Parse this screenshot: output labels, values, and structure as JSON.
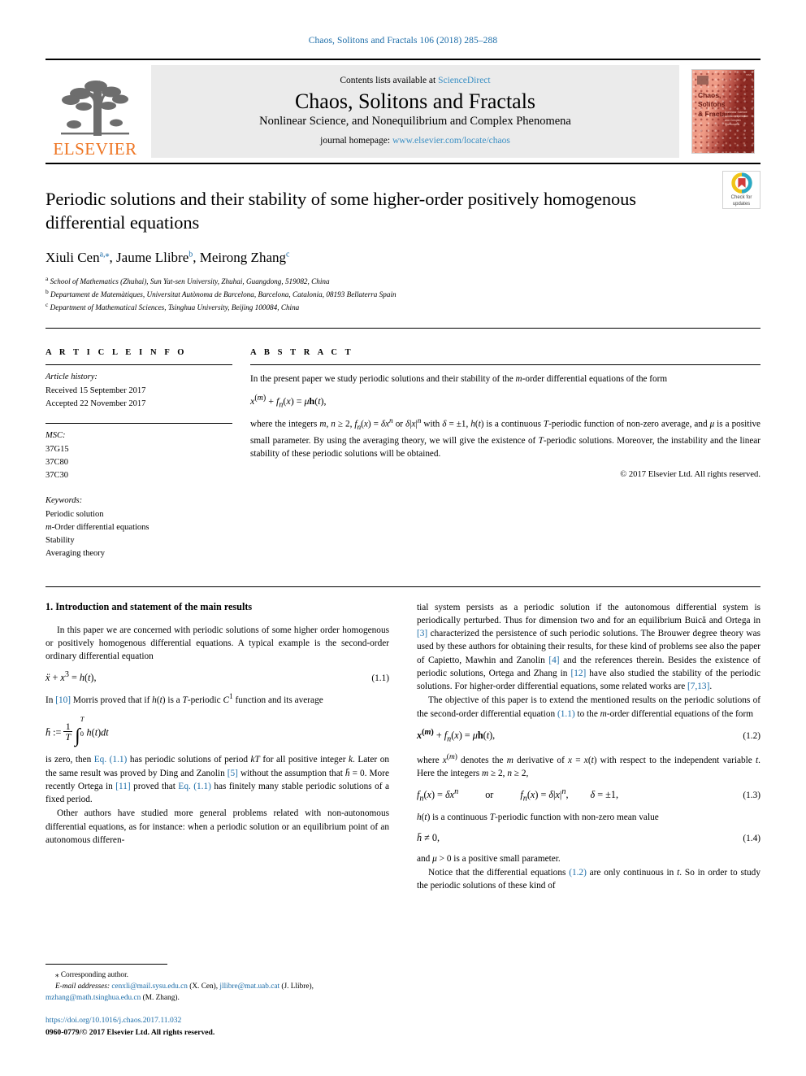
{
  "running_head": "Chaos, Solitons and Fractals 106 (2018) 285–288",
  "masthead": {
    "publisher": "ELSEVIER",
    "contents_prefix": "Contents lists available at ",
    "contents_link": "ScienceDirect",
    "journal_title": "Chaos, Solitons and Fractals",
    "journal_subtitle": "Nonlinear Science, and Nonequilibrium and Complex Phenomena",
    "homepage_prefix": "journal homepage: ",
    "homepage_link": "www.elsevier.com/locate/chaos",
    "cover": {
      "title_line1": "Chaos,",
      "title_line2": "Solitons",
      "title_line3": "& Fractals",
      "sub_text": "Nonlinear Science and Nonequilibrium and Complex Phenomena",
      "corner_text": "ISSN"
    }
  },
  "article": {
    "title": "Periodic solutions and their stability of some higher-order positively homogenous differential equations",
    "crossmark_label_line1": "Check for",
    "crossmark_label_line2": "updates",
    "authors_html": "Xiuli Cen<sup class=\"aff\">a</sup><sup class=\"star\">,⁎</sup>, Jaume Llibre<sup class=\"aff\">b</sup>, Meirong Zhang<sup class=\"aff\">c</sup>",
    "affiliations": [
      {
        "marker": "a",
        "text": "School of Mathematics (Zhuhai), Sun Yat-sen University, Zhuhai, Guangdong, 519082, China"
      },
      {
        "marker": "b",
        "text": "Departament de Matemàtiques, Universitat Autònoma de Barcelona, Barcelona, Catalonia, 08193 Bellaterra Spain"
      },
      {
        "marker": "c",
        "text": "Department of Mathematical Sciences, Tsinghua University, Beijing 100084, China"
      }
    ]
  },
  "article_info": {
    "heading": "A R T I C L E   I N F O",
    "history_label": "Article history:",
    "history": [
      "Received 15 September 2017",
      "Accepted 22 November 2017"
    ],
    "msc_label": "MSC:",
    "msc": [
      "37G15",
      "37C80",
      "37C30"
    ],
    "keywords_label": "Keywords:",
    "keywords": [
      "Periodic solution",
      "m-Order differential equations",
      "Stability",
      "Averaging theory"
    ]
  },
  "abstract": {
    "heading": "A B S T R A C T",
    "para1": "In the present paper we study periodic solutions and their stability of the m-order differential equations of the form",
    "equation": "x⁽ᵐ⁾ + fₙ(x) = μh(t),",
    "para2": "where the integers m, n ≥ 2, fₙ(x) = δxⁿ or δ|x|ⁿ with δ = ±1, h(t) is a continuous T-periodic function of non-zero average, and μ is a positive small parameter. By using the averaging theory, we will give the existence of T-periodic solutions. Moreover, the instability and the linear stability of these periodic solutions will be obtained.",
    "copyright": "© 2017 Elsevier Ltd. All rights reserved."
  },
  "body": {
    "section_title": "1. Introduction and statement of the main results",
    "left": {
      "p1": "In this paper we are concerned with periodic solutions of some higher order homogenous or positively homogenous differential equations. A typical example is the second-order ordinary differential equation",
      "eq11": "ẍ + x³ = h(t),",
      "eq11_num": "(1.1)",
      "p2_a": "In ",
      "p2_ref": "[10]",
      "p2_b": " Morris proved that if h(t) is a T-periodic C¹ function and its average",
      "eq_avg": "h̄ := (1/T) ∫₀ᵀ h(t)dt",
      "p3_a": "is zero, then ",
      "p3_ref1": "Eq. (1.1)",
      "p3_b": " has periodic solutions of period kT for all positive integer k. Later on the same result was proved by Ding and Zanolin ",
      "p3_ref2": "[5]",
      "p3_c": " without the assumption that h̄ = 0. More recently Ortega in ",
      "p3_ref3": "[11]",
      "p3_d": " proved that ",
      "p3_ref4": "Eq. (1.1)",
      "p3_e": " has finitely many stable periodic solutions of a fixed period.",
      "p4": "Other authors have studied more general problems related with non-autonomous differential equations, as for instance: when a periodic solution or an equilibrium point of an autonomous differen-"
    },
    "right": {
      "p1_a": "tial system persists as a periodic solution if the autonomous differential system is periodically perturbed. Thus for dimension two and for an equilibrium Buică and Ortega in ",
      "p1_ref1": "[3]",
      "p1_b": " characterized the persistence of such periodic solutions. The Brouwer degree theory was used by these authors for obtaining their results, for these kind of problems see also the paper of Capietto, Mawhin and Zanolin ",
      "p1_ref2": "[4]",
      "p1_c": " and the references therein. Besides the existence of periodic solutions, Ortega and Zhang in ",
      "p1_ref3": "[12]",
      "p1_d": " have also studied the stability of the periodic solutions. For higher-order differential equations, some related works are ",
      "p1_ref4": "[7,13]",
      "p1_e": ".",
      "p2_a": "The objective of this paper is to extend the mentioned results on the periodic solutions of the second-order differential equation ",
      "p2_ref": "(1.1)",
      "p2_b": " to the m-order differential equations of the form",
      "eq12": "x⁽ᵐ⁾ + fₙ(x) = μh(t),",
      "eq12_num": "(1.2)",
      "p3": "where x⁽ᵐ⁾ denotes the m derivative of x = x(t) with respect to the independent variable t. Here the integers m ≥ 2, n ≥ 2,",
      "eq13_left": "fₙ(x) = δxⁿ",
      "eq13_or": "or",
      "eq13_mid": "fₙ(x) = δ|x|ⁿ,",
      "eq13_right": "δ = ±1,",
      "eq13_num": "(1.3)",
      "p4": "h(t) is a continuous T-periodic function with non-zero mean value",
      "eq14": "h̄ ≠ 0,",
      "eq14_num": "(1.4)",
      "p5": "and μ > 0 is a positive small parameter.",
      "p6_a": "Notice that the differential equations ",
      "p6_ref": "(1.2)",
      "p6_b": " are only continuous in t. So in order to study the periodic solutions of these kind of"
    }
  },
  "footnote": {
    "corresponding_star": "⁎",
    "corresponding": "Corresponding author.",
    "email_label": "E-mail addresses:",
    "emails": [
      {
        "address": "cenxli@mail.sysu.edu.cn",
        "name": "(X. Cen)"
      },
      {
        "address": "jllibre@mat.uab.cat",
        "name": "(J. Llibre)"
      },
      {
        "address": "mzhang@math.tsinghua.edu.cn",
        "name": "(M. Zhang)"
      }
    ],
    "doi": "https://doi.org/10.1016/j.chaos.2017.11.032",
    "issn_line": "0960-0779/© 2017 Elsevier Ltd. All rights reserved."
  },
  "colors": {
    "link_blue": "#1b6ca8",
    "sd_blue": "#3a8fc4",
    "elsevier_orange": "#ee7523",
    "masthead_grey": "#ebebeb"
  }
}
